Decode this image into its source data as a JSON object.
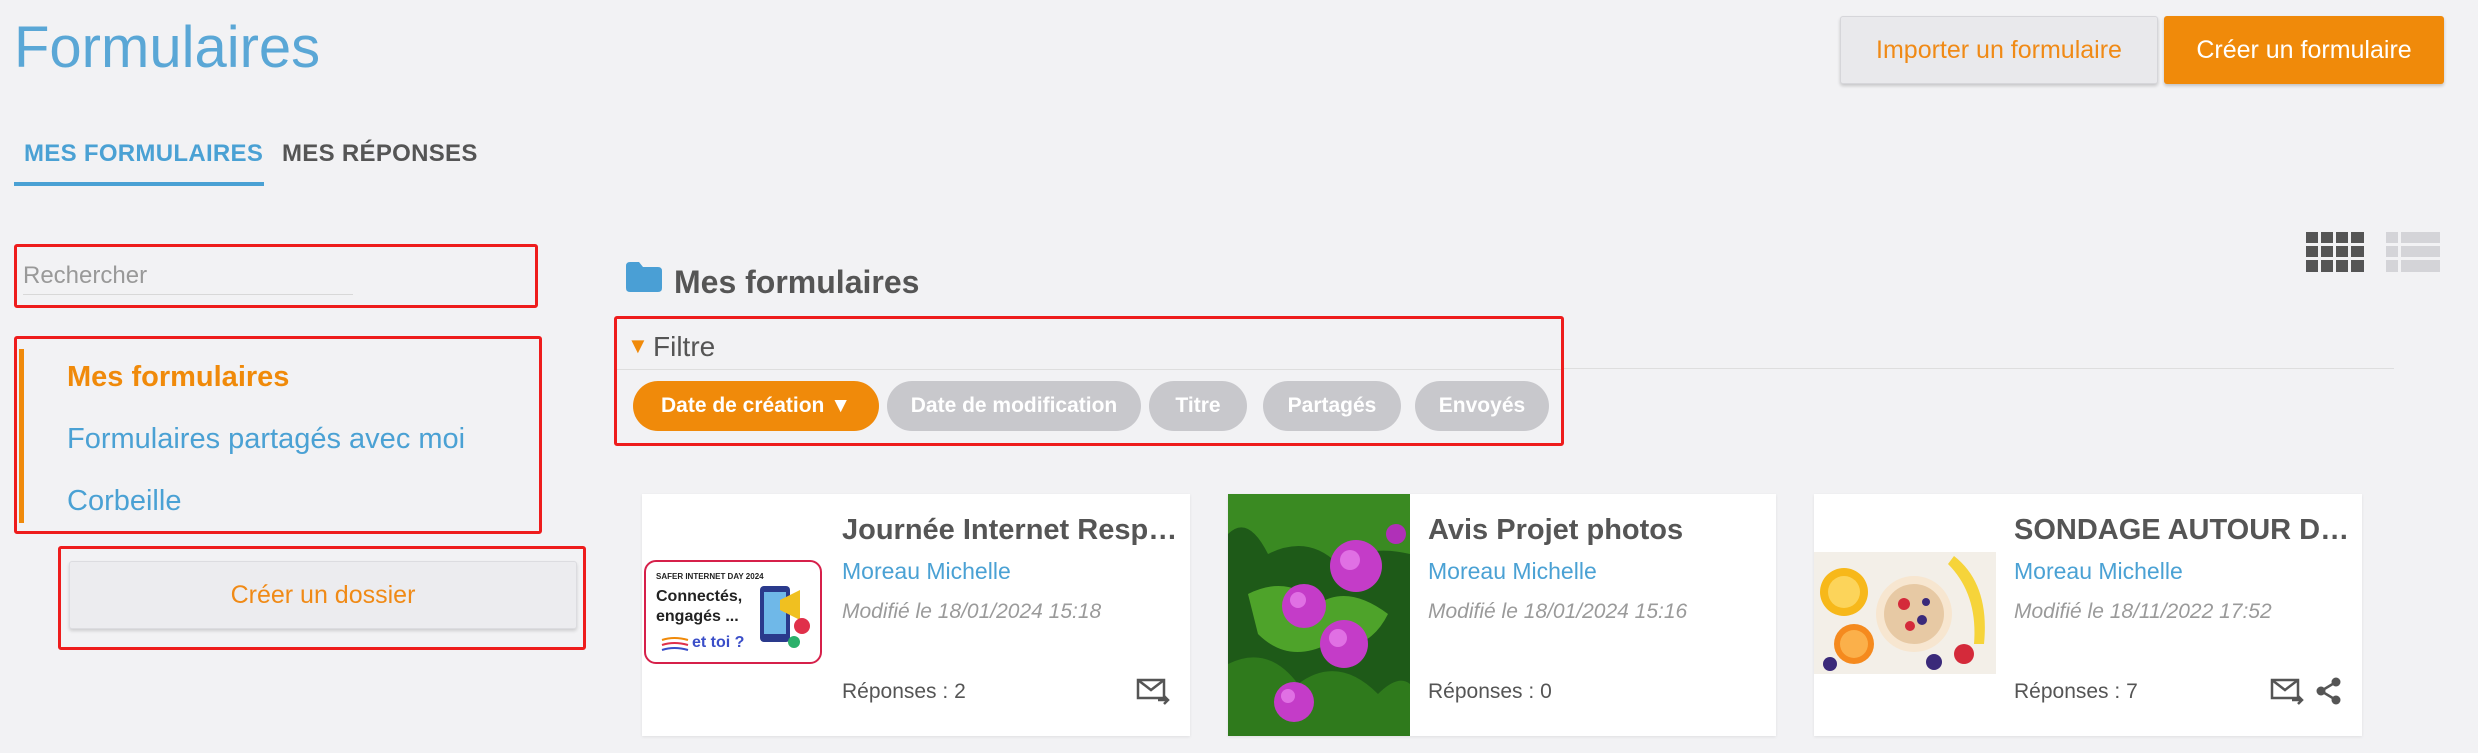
{
  "header": {
    "title": "Formulaires",
    "import_label": "Importer un formulaire",
    "create_label": "Créer un formulaire"
  },
  "tabs": [
    {
      "label": "MES FORMULAIRES",
      "active": true
    },
    {
      "label": "MES RÉPONSES",
      "active": false
    }
  ],
  "sidebar": {
    "search_placeholder": "Rechercher",
    "items": [
      {
        "label": "Mes formulaires",
        "active": true
      },
      {
        "label": "Formulaires partagés avec moi",
        "active": false
      },
      {
        "label": "Corbeille",
        "active": false
      }
    ],
    "create_folder_label": "Créer un dossier"
  },
  "main": {
    "section_title": "Mes formulaires",
    "filter_label": "Filtre",
    "filter_arrow": "▼",
    "chips": [
      {
        "label": "Date de création ▼",
        "active": true
      },
      {
        "label": "Date de modification",
        "active": false
      },
      {
        "label": "Titre",
        "active": false
      },
      {
        "label": "Partagés",
        "active": false
      },
      {
        "label": "Envoyés",
        "active": false
      }
    ],
    "view_modes": [
      "grid-view-icon",
      "list-view-icon"
    ],
    "cards": [
      {
        "title": "Journée Internet Respo...",
        "author": "Moreau Michelle",
        "modified": "Modifié le 18/01/2024 15:18",
        "responses": "Réponses : 2",
        "icons": [
          "send-mail-icon"
        ],
        "thumb_text": {
          "line1": "SAFER INTERNET DAY 2024",
          "line2": "Connectés,",
          "line3": "engagés ...",
          "line4": "et toi ?"
        }
      },
      {
        "title": "Avis Projet photos",
        "author": "Moreau Michelle",
        "modified": "Modifié le 18/01/2024 15:16",
        "responses": "Réponses : 0",
        "icons": []
      },
      {
        "title": "SONDAGE AUTOUR DU ...",
        "author": "Moreau Michelle",
        "modified": "Modifié le 18/11/2022 17:52",
        "responses": "Réponses : 7",
        "icons": [
          "send-mail-icon",
          "share-icon"
        ]
      }
    ]
  },
  "colors": {
    "accent_orange": "#f08a0a",
    "accent_blue": "#4aa1d4",
    "highlight_red": "#ee1c1c"
  }
}
